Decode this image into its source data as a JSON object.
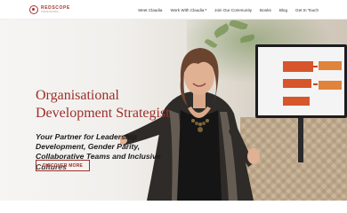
{
  "brand": {
    "name": "REDSCOPE",
    "tagline": "CONSULTING"
  },
  "nav": {
    "items": [
      {
        "label": "Meet Claudia",
        "has_dropdown": false
      },
      {
        "label": "Work With Claudia",
        "has_dropdown": true
      },
      {
        "label": "Join Our Community",
        "has_dropdown": false
      },
      {
        "label": "Books",
        "has_dropdown": false
      },
      {
        "label": "Blog",
        "has_dropdown": false
      },
      {
        "label": "Get In Touch",
        "has_dropdown": false
      }
    ]
  },
  "hero": {
    "title_line1": "Organisational",
    "title_line2": "Development Strategist",
    "subtitle": "Your Partner for Leadership Development, Gender Parity, Collaborative Teams and Inclusive Cultures",
    "cta_label": "DISCOVER MORE"
  },
  "colors": {
    "brand_red": "#9b2f2a",
    "text_dark": "#1b1b1b"
  }
}
